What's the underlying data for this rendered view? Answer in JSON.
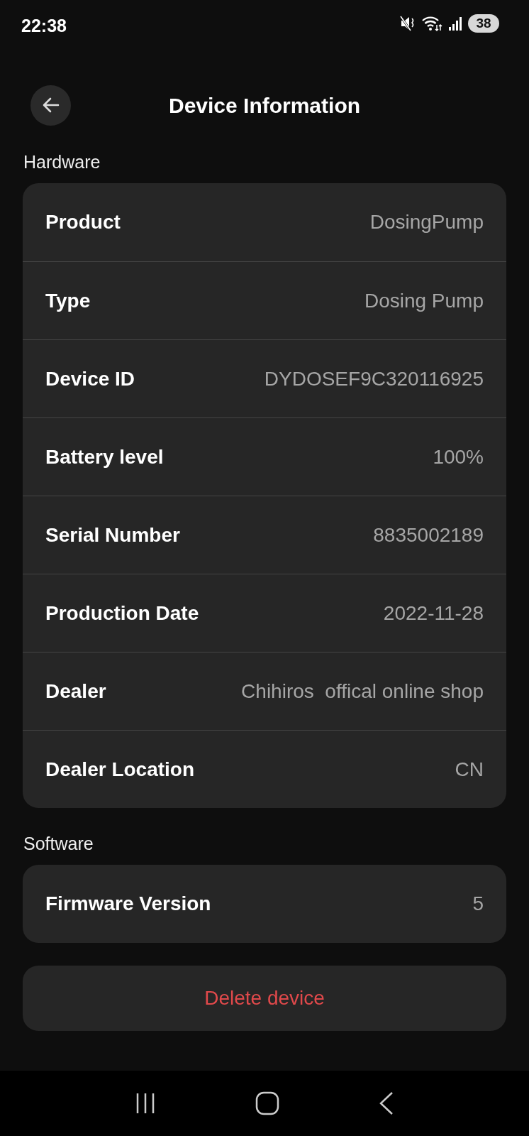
{
  "status_bar": {
    "time": "22:38",
    "battery": "38"
  },
  "header": {
    "title": "Device Information"
  },
  "sections": [
    {
      "title": "Hardware",
      "rows": [
        {
          "label": "Product",
          "value": "DosingPump"
        },
        {
          "label": "Type",
          "value": "Dosing Pump"
        },
        {
          "label": "Device ID",
          "value": "DYDOSEF9C320116925"
        },
        {
          "label": "Battery level",
          "value": "100%"
        },
        {
          "label": "Serial Number",
          "value": "8835002189"
        },
        {
          "label": "Production Date",
          "value": "2022-11-28"
        },
        {
          "label": "Dealer",
          "value": "Chihiros  offical online shop"
        },
        {
          "label": "Dealer Location",
          "value": "CN"
        }
      ]
    },
    {
      "title": "Software",
      "rows": [
        {
          "label": "Firmware Version",
          "value": "5"
        }
      ]
    }
  ],
  "delete_button": "Delete device"
}
